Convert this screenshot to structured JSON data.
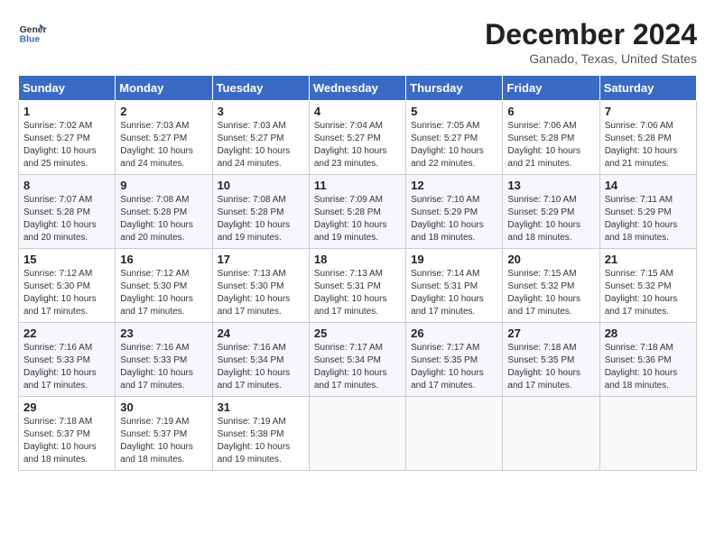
{
  "header": {
    "logo_line1": "General",
    "logo_line2": "Blue",
    "title": "December 2024",
    "subtitle": "Ganado, Texas, United States"
  },
  "calendar": {
    "days_of_week": [
      "Sunday",
      "Monday",
      "Tuesday",
      "Wednesday",
      "Thursday",
      "Friday",
      "Saturday"
    ],
    "weeks": [
      [
        {
          "day": "1",
          "sunrise": "7:02 AM",
          "sunset": "5:27 PM",
          "daylight": "10 hours and 25 minutes."
        },
        {
          "day": "2",
          "sunrise": "7:03 AM",
          "sunset": "5:27 PM",
          "daylight": "10 hours and 24 minutes."
        },
        {
          "day": "3",
          "sunrise": "7:03 AM",
          "sunset": "5:27 PM",
          "daylight": "10 hours and 24 minutes."
        },
        {
          "day": "4",
          "sunrise": "7:04 AM",
          "sunset": "5:27 PM",
          "daylight": "10 hours and 23 minutes."
        },
        {
          "day": "5",
          "sunrise": "7:05 AM",
          "sunset": "5:27 PM",
          "daylight": "10 hours and 22 minutes."
        },
        {
          "day": "6",
          "sunrise": "7:06 AM",
          "sunset": "5:28 PM",
          "daylight": "10 hours and 21 minutes."
        },
        {
          "day": "7",
          "sunrise": "7:06 AM",
          "sunset": "5:28 PM",
          "daylight": "10 hours and 21 minutes."
        }
      ],
      [
        {
          "day": "8",
          "sunrise": "7:07 AM",
          "sunset": "5:28 PM",
          "daylight": "10 hours and 20 minutes."
        },
        {
          "day": "9",
          "sunrise": "7:08 AM",
          "sunset": "5:28 PM",
          "daylight": "10 hours and 20 minutes."
        },
        {
          "day": "10",
          "sunrise": "7:08 AM",
          "sunset": "5:28 PM",
          "daylight": "10 hours and 19 minutes."
        },
        {
          "day": "11",
          "sunrise": "7:09 AM",
          "sunset": "5:28 PM",
          "daylight": "10 hours and 19 minutes."
        },
        {
          "day": "12",
          "sunrise": "7:10 AM",
          "sunset": "5:29 PM",
          "daylight": "10 hours and 18 minutes."
        },
        {
          "day": "13",
          "sunrise": "7:10 AM",
          "sunset": "5:29 PM",
          "daylight": "10 hours and 18 minutes."
        },
        {
          "day": "14",
          "sunrise": "7:11 AM",
          "sunset": "5:29 PM",
          "daylight": "10 hours and 18 minutes."
        }
      ],
      [
        {
          "day": "15",
          "sunrise": "7:12 AM",
          "sunset": "5:30 PM",
          "daylight": "10 hours and 17 minutes."
        },
        {
          "day": "16",
          "sunrise": "7:12 AM",
          "sunset": "5:30 PM",
          "daylight": "10 hours and 17 minutes."
        },
        {
          "day": "17",
          "sunrise": "7:13 AM",
          "sunset": "5:30 PM",
          "daylight": "10 hours and 17 minutes."
        },
        {
          "day": "18",
          "sunrise": "7:13 AM",
          "sunset": "5:31 PM",
          "daylight": "10 hours and 17 minutes."
        },
        {
          "day": "19",
          "sunrise": "7:14 AM",
          "sunset": "5:31 PM",
          "daylight": "10 hours and 17 minutes."
        },
        {
          "day": "20",
          "sunrise": "7:15 AM",
          "sunset": "5:32 PM",
          "daylight": "10 hours and 17 minutes."
        },
        {
          "day": "21",
          "sunrise": "7:15 AM",
          "sunset": "5:32 PM",
          "daylight": "10 hours and 17 minutes."
        }
      ],
      [
        {
          "day": "22",
          "sunrise": "7:16 AM",
          "sunset": "5:33 PM",
          "daylight": "10 hours and 17 minutes."
        },
        {
          "day": "23",
          "sunrise": "7:16 AM",
          "sunset": "5:33 PM",
          "daylight": "10 hours and 17 minutes."
        },
        {
          "day": "24",
          "sunrise": "7:16 AM",
          "sunset": "5:34 PM",
          "daylight": "10 hours and 17 minutes."
        },
        {
          "day": "25",
          "sunrise": "7:17 AM",
          "sunset": "5:34 PM",
          "daylight": "10 hours and 17 minutes."
        },
        {
          "day": "26",
          "sunrise": "7:17 AM",
          "sunset": "5:35 PM",
          "daylight": "10 hours and 17 minutes."
        },
        {
          "day": "27",
          "sunrise": "7:18 AM",
          "sunset": "5:35 PM",
          "daylight": "10 hours and 17 minutes."
        },
        {
          "day": "28",
          "sunrise": "7:18 AM",
          "sunset": "5:36 PM",
          "daylight": "10 hours and 18 minutes."
        }
      ],
      [
        {
          "day": "29",
          "sunrise": "7:18 AM",
          "sunset": "5:37 PM",
          "daylight": "10 hours and 18 minutes."
        },
        {
          "day": "30",
          "sunrise": "7:19 AM",
          "sunset": "5:37 PM",
          "daylight": "10 hours and 18 minutes."
        },
        {
          "day": "31",
          "sunrise": "7:19 AM",
          "sunset": "5:38 PM",
          "daylight": "10 hours and 19 minutes."
        },
        null,
        null,
        null,
        null
      ]
    ]
  }
}
